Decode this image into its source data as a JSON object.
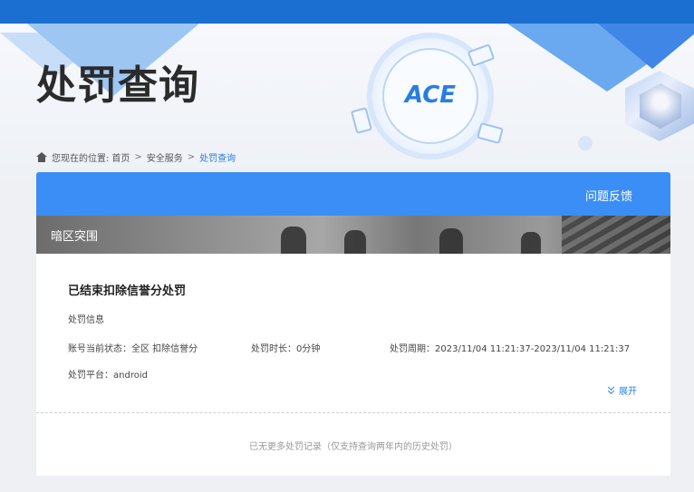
{
  "page": {
    "title": "处罚查询"
  },
  "breadcrumb": {
    "prefix": "您现在的位置:",
    "items": [
      "首页",
      "安全服务"
    ],
    "separator": ">",
    "current": "处罚查询"
  },
  "panel": {
    "feedback_label": "问题反馈",
    "game_name": "暗区突围"
  },
  "record": {
    "status_title": "已结束扣除信誉分处罚",
    "section_label": "处罚信息",
    "account_status": "账号当前状态：全区 扣除信誉分",
    "duration": "处罚时长：0分钟",
    "period": "处罚周期：2023/11/04 11:21:37-2023/11/04 11:21:37",
    "platform": "处罚平台：android",
    "expand_label": "展开"
  },
  "footer": {
    "no_more": "已无更多处罚记录（仅支持查询两年内的历史处罚）"
  },
  "icons": {
    "breadcrumb": "home-icon",
    "expand": "chevron-double-down-icon"
  },
  "colors": {
    "topbar": "#1a6fd1",
    "panel_header": "#3a8ef5",
    "link": "#2a7de0"
  }
}
